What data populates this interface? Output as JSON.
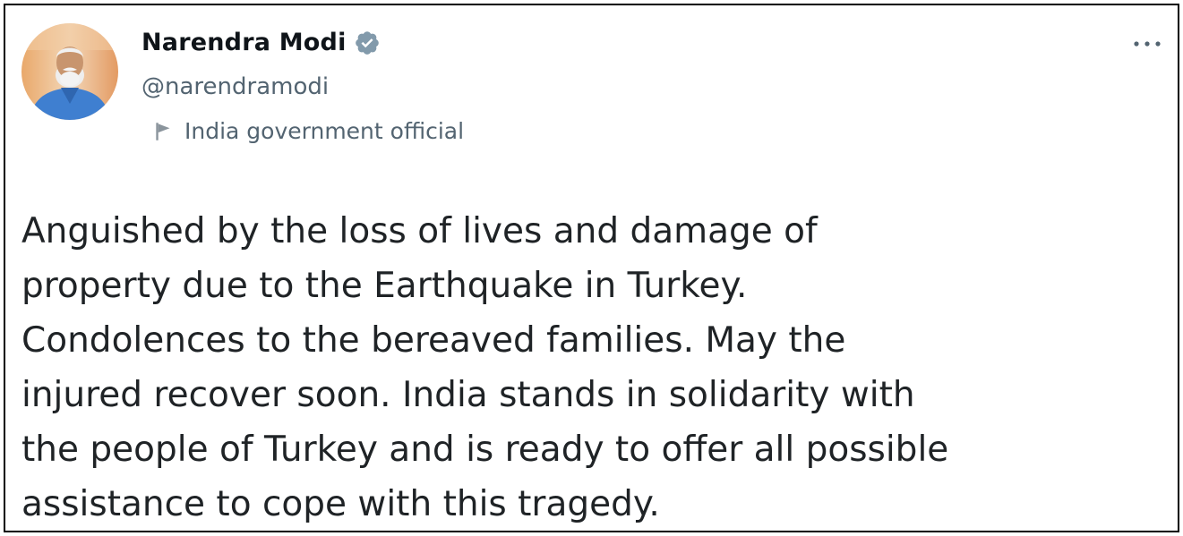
{
  "author": {
    "display_name": "Narendra Modi",
    "handle": "@narendramodi",
    "verified": true,
    "affiliation": "India government official",
    "avatar_icon": "profile-photo",
    "verified_icon": "verified-badge-icon",
    "affiliation_icon": "flag-icon"
  },
  "menu": {
    "icon": "more-options-icon"
  },
  "tweet": {
    "text": "Anguished by the loss of lives and damage of\nproperty due to the Earthquake in Turkey.\nCondolences to the bereaved families. May the\ninjured recover soon. India stands in solidarity with\nthe people of Turkey and is ready to offer all possible\nassistance to cope with this tragedy."
  },
  "colors": {
    "name": "#0f1419",
    "secondary": "#536471",
    "verified_badge": "#829aab",
    "border": "#000000"
  }
}
